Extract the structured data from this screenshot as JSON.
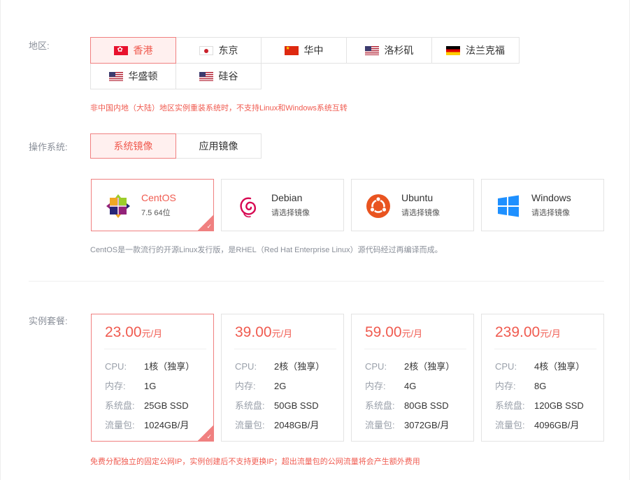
{
  "region": {
    "label": "地区:",
    "items": [
      {
        "name": "香港",
        "flag": "hk",
        "active": true
      },
      {
        "name": "东京",
        "flag": "jp",
        "active": false
      },
      {
        "name": "华中",
        "flag": "cn",
        "active": false
      },
      {
        "name": "洛杉矶",
        "flag": "us",
        "active": false
      },
      {
        "name": "法兰克福",
        "flag": "de",
        "active": false
      },
      {
        "name": "华盛顿",
        "flag": "us",
        "active": false
      },
      {
        "name": "硅谷",
        "flag": "us",
        "active": false
      }
    ],
    "note": "非中国内地（大陆）地区实例重装系统时，不支持Linux和Windows系统互转"
  },
  "os": {
    "label": "操作系统:",
    "tabs": [
      {
        "label": "系统镜像",
        "active": true
      },
      {
        "label": "应用镜像",
        "active": false
      }
    ],
    "cards": [
      {
        "name": "CentOS",
        "sub": "7.5 64位",
        "icon": "centos-icon",
        "active": true
      },
      {
        "name": "Debian",
        "sub": "请选择镜像",
        "icon": "debian-icon",
        "active": false
      },
      {
        "name": "Ubuntu",
        "sub": "请选择镜像",
        "icon": "ubuntu-icon",
        "active": false
      },
      {
        "name": "Windows",
        "sub": "请选择镜像",
        "icon": "windows-icon",
        "active": false
      }
    ],
    "note": "CentOS是一款流行的开源Linux发行版，是RHEL（Red Hat Enterprise Linux）源代码经过再编译而成。"
  },
  "plans": {
    "label": "实例套餐:",
    "spec_labels": {
      "cpu": "CPU:",
      "mem": "内存:",
      "disk": "系统盘:",
      "traffic": "流量包:"
    },
    "unit": "元/月",
    "items": [
      {
        "price": "23.00",
        "cpu": "1核（独享）",
        "mem": "1G",
        "disk": "25GB SSD",
        "traffic": "1024GB/月",
        "active": true
      },
      {
        "price": "39.00",
        "cpu": "2核（独享）",
        "mem": "2G",
        "disk": "50GB SSD",
        "traffic": "2048GB/月",
        "active": false
      },
      {
        "price": "59.00",
        "cpu": "2核（独享）",
        "mem": "4G",
        "disk": "80GB SSD",
        "traffic": "3072GB/月",
        "active": false
      },
      {
        "price": "239.00",
        "cpu": "4核（独享）",
        "mem": "8G",
        "disk": "120GB SSD",
        "traffic": "4096GB/月",
        "active": false
      }
    ],
    "note": "免费分配独立的固定公网IP，实例创建后不支持更换IP；超出流量包的公网流量将会产生额外费用"
  },
  "colors": {
    "accent": "#f05b50",
    "accent_border": "#f08080",
    "accent_bg": "#fff0ef"
  }
}
